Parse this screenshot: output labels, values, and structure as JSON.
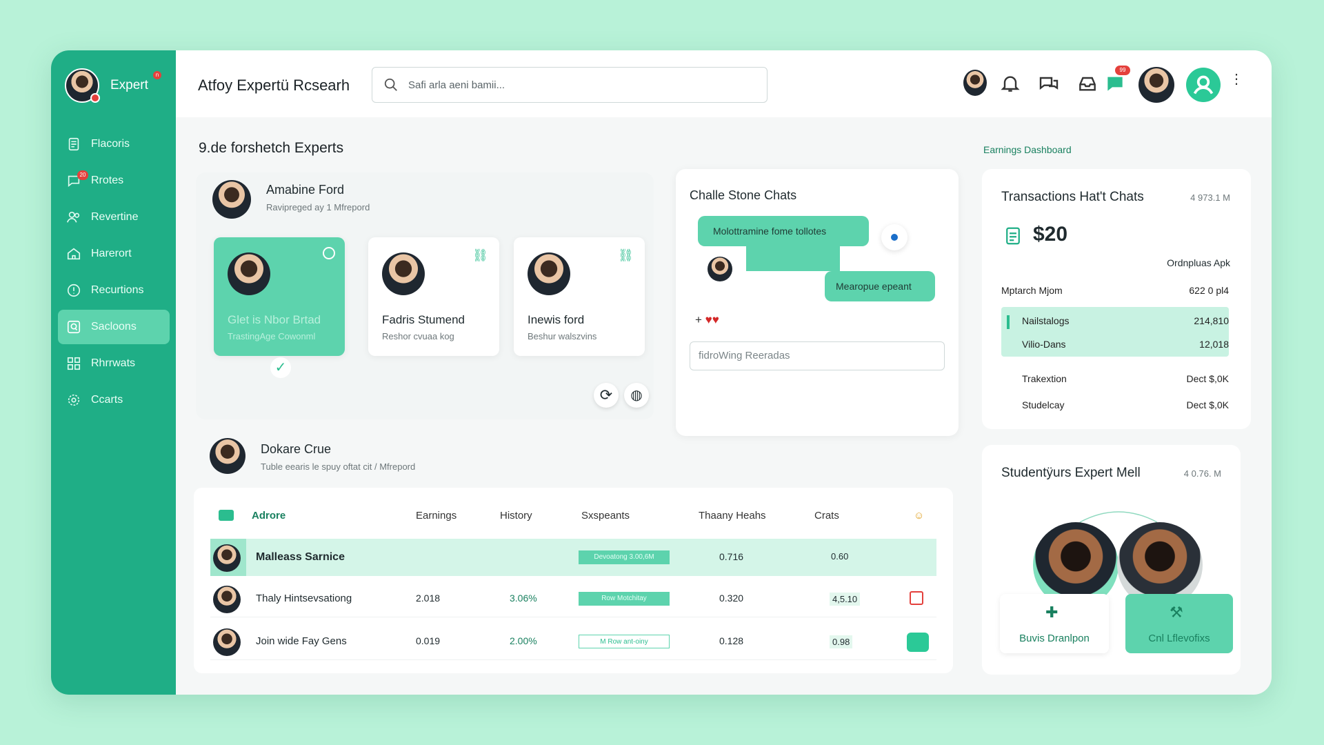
{
  "app": {
    "brand": "Expert",
    "brand_badge": "n",
    "title": "Atfoy Expertü Rcsearh"
  },
  "search": {
    "placeholder": "Safi arla aeni bamii..."
  },
  "header_badges": {
    "chat": "99"
  },
  "sidebar": {
    "items": [
      {
        "label": "Flacoris",
        "icon": "document-icon"
      },
      {
        "label": "Rrotes",
        "icon": "chat-icon",
        "badge": "20"
      },
      {
        "label": "Revertine",
        "icon": "users-icon"
      },
      {
        "label": "Harerort",
        "icon": "home-icon"
      },
      {
        "label": "Recurtions",
        "icon": "help-icon"
      },
      {
        "label": "Sacloons",
        "icon": "search-icon",
        "active": true
      },
      {
        "label": "Rhrrwats",
        "icon": "grid-icon"
      },
      {
        "label": "Ccarts",
        "icon": "gear-icon"
      }
    ]
  },
  "experts": {
    "heading": "9.de forshetch Experts",
    "featured": {
      "name": "Amabine Ford",
      "sub": "Ravipreged ay 1 Mfrepord"
    },
    "cards": [
      {
        "name": "Glet is Nbor Brtad",
        "sub": "TrastingAge Cowonml"
      },
      {
        "name": "Fadris Stumend",
        "sub": "Reshor cvuaa kog"
      },
      {
        "name": "Inewis ford",
        "sub": "Beshur walszvins"
      }
    ]
  },
  "chat": {
    "title": "Challe Stone Chats",
    "msg1": "Molottramine fome tollotes",
    "msg2": "Mearopue epeant",
    "reactions": "+",
    "input_placeholder": "fidroWing Reeradas"
  },
  "earnings": {
    "label": "Earnings Dashboard",
    "card_title": "Transactions Hat't Chats",
    "card_meta": "4 973.1 M",
    "amount": "$20",
    "amount_sub": "Ordnpluas Apk",
    "rows": [
      {
        "label": "Mptarch Mjom",
        "value": "622 0 pl4"
      },
      {
        "label": "Nailstalogs",
        "value": "214,810"
      },
      {
        "label": "Vilio-Dans",
        "value": "12,018"
      },
      {
        "label": "Trakextion",
        "value": "Dect $,0K"
      },
      {
        "label": "Studelcay",
        "value": "Dect $,0K"
      }
    ]
  },
  "second_expert": {
    "name": "Dokare Crue",
    "sub": "Tuble eearis le spuy oftat cit / Mfrepord"
  },
  "table": {
    "headers": [
      "Adrore",
      "Earnings",
      "History",
      "Sxspeants",
      "Thaany Heahs",
      "Crats"
    ],
    "rows": [
      {
        "name": "Malleass Sarnice",
        "earnings": "",
        "history": "",
        "pill": "Devoatong 3.00,6M",
        "heahs": "0.716",
        "crats": "0.60"
      },
      {
        "name": "Thaly Hintsevsationg",
        "earnings": "2.018",
        "history": "3.06%",
        "pill": "Row Motchitay",
        "heahs": "0.320",
        "crats": "4,5.10"
      },
      {
        "name": "Join wide Fay Gens",
        "earnings": "0.019",
        "history": "2.00%",
        "pill": "M Row ant-oiny",
        "heahs": "0.128",
        "crats": "0.98"
      }
    ]
  },
  "students": {
    "title": "Studentÿurs Expert Mell",
    "meta": "4 0.76. M",
    "btn1": "Buvis Dranlpon",
    "btn2": "Cnl Lflevofixs"
  },
  "colors": {
    "accent": "#1fae86",
    "accent_light": "#5dd3ad",
    "background": "#b8f2d8",
    "alert": "#e4403c"
  }
}
